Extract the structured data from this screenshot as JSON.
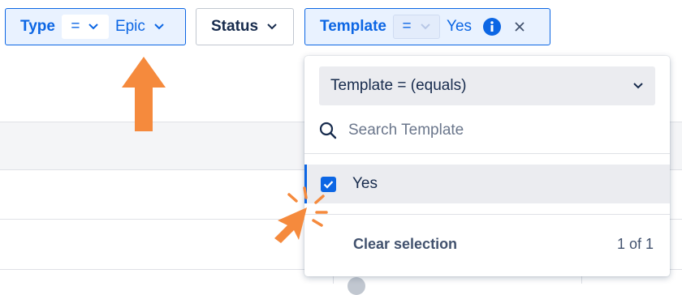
{
  "filters": {
    "type": {
      "label": "Type",
      "operator": "=",
      "value": "Epic"
    },
    "status": {
      "label": "Status"
    },
    "template": {
      "label": "Template",
      "operator": "=",
      "value": "Yes"
    }
  },
  "dropdown": {
    "operator_select": "Template = (equals)",
    "search_placeholder": "Search Template",
    "options": [
      {
        "label": "Yes",
        "checked": true
      }
    ],
    "clear_label": "Clear selection",
    "count": "1 of 1"
  },
  "colors": {
    "accent": "#0c66e4",
    "annotation": "#f58a3d"
  },
  "icons": [
    "chevron-down-icon",
    "info-icon",
    "close-icon",
    "search-icon",
    "check-icon",
    "arrow-up-icon",
    "click-burst-icon"
  ]
}
